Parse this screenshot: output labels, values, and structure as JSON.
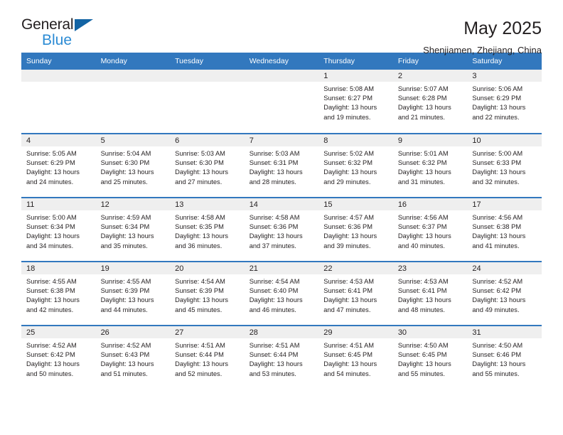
{
  "logo": {
    "primary_text": "General",
    "secondary_text": "Blue",
    "primary_color": "#231f20",
    "secondary_color": "#2b8bd4",
    "triangle_color": "#1364a4"
  },
  "header": {
    "title": "May 2025",
    "subtitle": "Shenjiamen, Zhejiang, China"
  },
  "theme": {
    "header_bar_color": "#3278be",
    "daynum_band_color": "#efefef",
    "text_color": "#231f20"
  },
  "weekday_headers": [
    "Sunday",
    "Monday",
    "Tuesday",
    "Wednesday",
    "Thursday",
    "Friday",
    "Saturday"
  ],
  "weeks": [
    [
      {
        "day": "",
        "empty": true
      },
      {
        "day": "",
        "empty": true
      },
      {
        "day": "",
        "empty": true
      },
      {
        "day": "",
        "empty": true
      },
      {
        "day": "1",
        "sunrise": "Sunrise: 5:08 AM",
        "sunset": "Sunset: 6:27 PM",
        "daylight_line1": "Daylight: 13 hours",
        "daylight_line2": "and 19 minutes."
      },
      {
        "day": "2",
        "sunrise": "Sunrise: 5:07 AM",
        "sunset": "Sunset: 6:28 PM",
        "daylight_line1": "Daylight: 13 hours",
        "daylight_line2": "and 21 minutes."
      },
      {
        "day": "3",
        "sunrise": "Sunrise: 5:06 AM",
        "sunset": "Sunset: 6:29 PM",
        "daylight_line1": "Daylight: 13 hours",
        "daylight_line2": "and 22 minutes."
      }
    ],
    [
      {
        "day": "4",
        "sunrise": "Sunrise: 5:05 AM",
        "sunset": "Sunset: 6:29 PM",
        "daylight_line1": "Daylight: 13 hours",
        "daylight_line2": "and 24 minutes."
      },
      {
        "day": "5",
        "sunrise": "Sunrise: 5:04 AM",
        "sunset": "Sunset: 6:30 PM",
        "daylight_line1": "Daylight: 13 hours",
        "daylight_line2": "and 25 minutes."
      },
      {
        "day": "6",
        "sunrise": "Sunrise: 5:03 AM",
        "sunset": "Sunset: 6:30 PM",
        "daylight_line1": "Daylight: 13 hours",
        "daylight_line2": "and 27 minutes."
      },
      {
        "day": "7",
        "sunrise": "Sunrise: 5:03 AM",
        "sunset": "Sunset: 6:31 PM",
        "daylight_line1": "Daylight: 13 hours",
        "daylight_line2": "and 28 minutes."
      },
      {
        "day": "8",
        "sunrise": "Sunrise: 5:02 AM",
        "sunset": "Sunset: 6:32 PM",
        "daylight_line1": "Daylight: 13 hours",
        "daylight_line2": "and 29 minutes."
      },
      {
        "day": "9",
        "sunrise": "Sunrise: 5:01 AM",
        "sunset": "Sunset: 6:32 PM",
        "daylight_line1": "Daylight: 13 hours",
        "daylight_line2": "and 31 minutes."
      },
      {
        "day": "10",
        "sunrise": "Sunrise: 5:00 AM",
        "sunset": "Sunset: 6:33 PM",
        "daylight_line1": "Daylight: 13 hours",
        "daylight_line2": "and 32 minutes."
      }
    ],
    [
      {
        "day": "11",
        "sunrise": "Sunrise: 5:00 AM",
        "sunset": "Sunset: 6:34 PM",
        "daylight_line1": "Daylight: 13 hours",
        "daylight_line2": "and 34 minutes."
      },
      {
        "day": "12",
        "sunrise": "Sunrise: 4:59 AM",
        "sunset": "Sunset: 6:34 PM",
        "daylight_line1": "Daylight: 13 hours",
        "daylight_line2": "and 35 minutes."
      },
      {
        "day": "13",
        "sunrise": "Sunrise: 4:58 AM",
        "sunset": "Sunset: 6:35 PM",
        "daylight_line1": "Daylight: 13 hours",
        "daylight_line2": "and 36 minutes."
      },
      {
        "day": "14",
        "sunrise": "Sunrise: 4:58 AM",
        "sunset": "Sunset: 6:36 PM",
        "daylight_line1": "Daylight: 13 hours",
        "daylight_line2": "and 37 minutes."
      },
      {
        "day": "15",
        "sunrise": "Sunrise: 4:57 AM",
        "sunset": "Sunset: 6:36 PM",
        "daylight_line1": "Daylight: 13 hours",
        "daylight_line2": "and 39 minutes."
      },
      {
        "day": "16",
        "sunrise": "Sunrise: 4:56 AM",
        "sunset": "Sunset: 6:37 PM",
        "daylight_line1": "Daylight: 13 hours",
        "daylight_line2": "and 40 minutes."
      },
      {
        "day": "17",
        "sunrise": "Sunrise: 4:56 AM",
        "sunset": "Sunset: 6:38 PM",
        "daylight_line1": "Daylight: 13 hours",
        "daylight_line2": "and 41 minutes."
      }
    ],
    [
      {
        "day": "18",
        "sunrise": "Sunrise: 4:55 AM",
        "sunset": "Sunset: 6:38 PM",
        "daylight_line1": "Daylight: 13 hours",
        "daylight_line2": "and 42 minutes."
      },
      {
        "day": "19",
        "sunrise": "Sunrise: 4:55 AM",
        "sunset": "Sunset: 6:39 PM",
        "daylight_line1": "Daylight: 13 hours",
        "daylight_line2": "and 44 minutes."
      },
      {
        "day": "20",
        "sunrise": "Sunrise: 4:54 AM",
        "sunset": "Sunset: 6:39 PM",
        "daylight_line1": "Daylight: 13 hours",
        "daylight_line2": "and 45 minutes."
      },
      {
        "day": "21",
        "sunrise": "Sunrise: 4:54 AM",
        "sunset": "Sunset: 6:40 PM",
        "daylight_line1": "Daylight: 13 hours",
        "daylight_line2": "and 46 minutes."
      },
      {
        "day": "22",
        "sunrise": "Sunrise: 4:53 AM",
        "sunset": "Sunset: 6:41 PM",
        "daylight_line1": "Daylight: 13 hours",
        "daylight_line2": "and 47 minutes."
      },
      {
        "day": "23",
        "sunrise": "Sunrise: 4:53 AM",
        "sunset": "Sunset: 6:41 PM",
        "daylight_line1": "Daylight: 13 hours",
        "daylight_line2": "and 48 minutes."
      },
      {
        "day": "24",
        "sunrise": "Sunrise: 4:52 AM",
        "sunset": "Sunset: 6:42 PM",
        "daylight_line1": "Daylight: 13 hours",
        "daylight_line2": "and 49 minutes."
      }
    ],
    [
      {
        "day": "25",
        "sunrise": "Sunrise: 4:52 AM",
        "sunset": "Sunset: 6:42 PM",
        "daylight_line1": "Daylight: 13 hours",
        "daylight_line2": "and 50 minutes."
      },
      {
        "day": "26",
        "sunrise": "Sunrise: 4:52 AM",
        "sunset": "Sunset: 6:43 PM",
        "daylight_line1": "Daylight: 13 hours",
        "daylight_line2": "and 51 minutes."
      },
      {
        "day": "27",
        "sunrise": "Sunrise: 4:51 AM",
        "sunset": "Sunset: 6:44 PM",
        "daylight_line1": "Daylight: 13 hours",
        "daylight_line2": "and 52 minutes."
      },
      {
        "day": "28",
        "sunrise": "Sunrise: 4:51 AM",
        "sunset": "Sunset: 6:44 PM",
        "daylight_line1": "Daylight: 13 hours",
        "daylight_line2": "and 53 minutes."
      },
      {
        "day": "29",
        "sunrise": "Sunrise: 4:51 AM",
        "sunset": "Sunset: 6:45 PM",
        "daylight_line1": "Daylight: 13 hours",
        "daylight_line2": "and 54 minutes."
      },
      {
        "day": "30",
        "sunrise": "Sunrise: 4:50 AM",
        "sunset": "Sunset: 6:45 PM",
        "daylight_line1": "Daylight: 13 hours",
        "daylight_line2": "and 55 minutes."
      },
      {
        "day": "31",
        "sunrise": "Sunrise: 4:50 AM",
        "sunset": "Sunset: 6:46 PM",
        "daylight_line1": "Daylight: 13 hours",
        "daylight_line2": "and 55 minutes."
      }
    ]
  ]
}
